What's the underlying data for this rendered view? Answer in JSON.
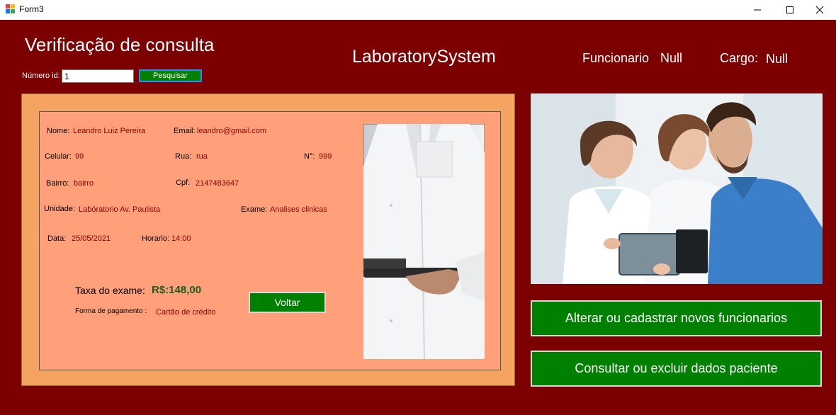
{
  "window": {
    "title": "Form3"
  },
  "header": {
    "page_title": "Verificação de consulta",
    "app_name": "LaboratorySystem",
    "funcionario_label": "Funcionario",
    "funcionario_value": "Null",
    "cargo_label": "Cargo:",
    "cargo_value": "Null"
  },
  "search": {
    "id_label": "Número id:",
    "id_value": "1",
    "button_label": "Pesquisar"
  },
  "patient": {
    "nome_label": "Nome:",
    "nome_value": "Leandro Luiz Pereira",
    "email_label": "Email:",
    "email_value": "leandro@gmail.com",
    "celular_label": "Celular:",
    "celular_value": "99",
    "rua_label": "Rua:",
    "rua_value": "rua",
    "numero_label": "N°:",
    "numero_value": "999",
    "bairro_label": "Bairro:",
    "bairro_value": "bairro",
    "cpf_label": "Cpf:",
    "cpf_value": "2147483647",
    "unidade_label": "Unidade:",
    "unidade_value": "Labóratorio Av. Paulista",
    "exame_label": "Exame:",
    "exame_value": "Analises clinicas",
    "data_label": "Data:",
    "data_value": "25/05/2021",
    "horario_label": "Horario:",
    "horario_value": "14:00",
    "taxa_label": "Taxa do exame:",
    "taxa_value": "R$:148,00",
    "pagamento_label": "Forma de pagamento :",
    "pagamento_value": "Cartão de crédito"
  },
  "actions": {
    "voltar": "Voltar",
    "alterar": "Alterar ou cadastrar novos funcionarios",
    "consultar": "Consultar ou excluir dados paciente"
  },
  "colors": {
    "background": "#7d0000",
    "outer_panel": "#f4a460",
    "inner_panel": "#ffa07a",
    "button_green": "#008000",
    "value_text": "#8b0000"
  }
}
